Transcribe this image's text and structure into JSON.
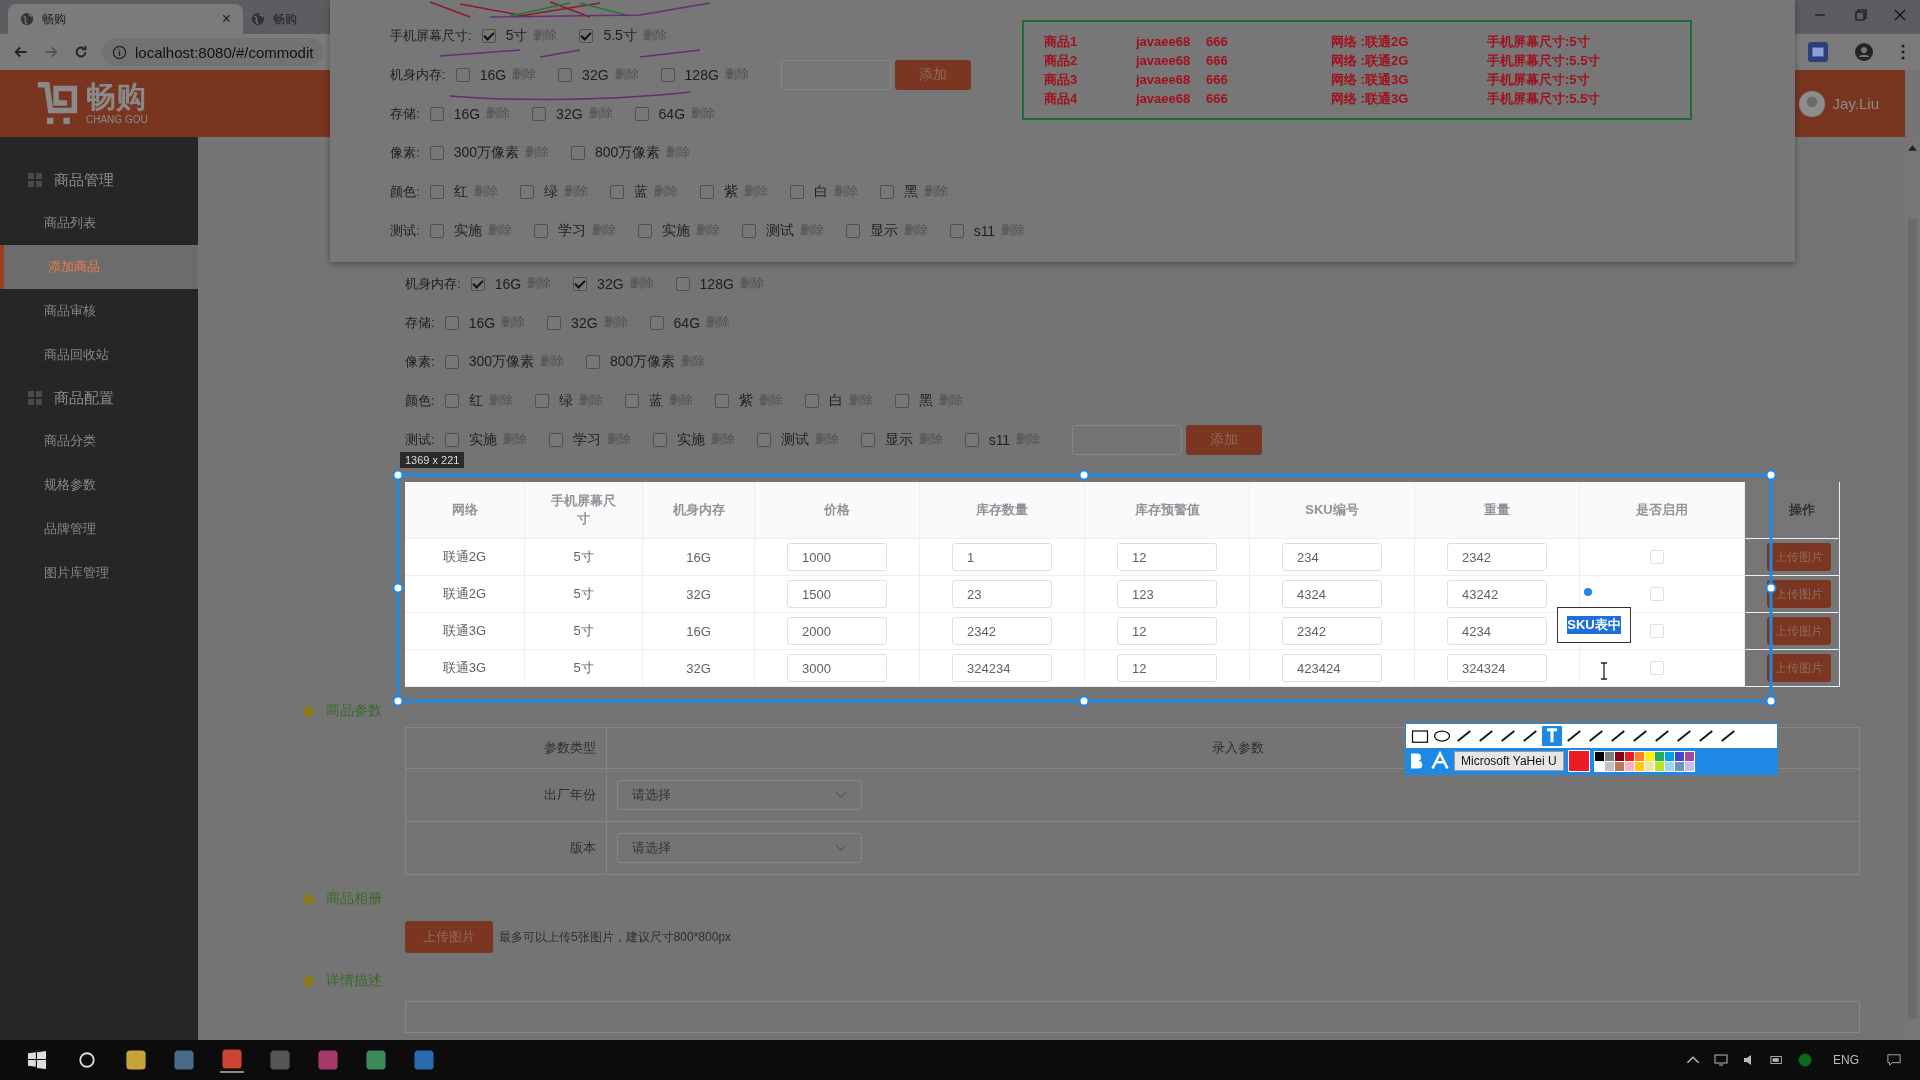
{
  "browser": {
    "tabs": [
      {
        "title": "畅购",
        "selected": true,
        "close": "×"
      },
      {
        "title": "畅购",
        "selected": false
      }
    ],
    "url": "localhost:8080/#/commodit"
  },
  "header": {
    "logo": "畅购",
    "logo_sub": "CHANG GOU",
    "user": "Jay.Liu"
  },
  "sidebar": [
    {
      "title": "商品管理",
      "items": [
        {
          "label": "商品列表",
          "selected": false
        },
        {
          "label": "添加商品",
          "selected": true
        },
        {
          "label": "商品审核",
          "selected": false
        },
        {
          "label": "商品回收站",
          "selected": false
        }
      ]
    },
    {
      "title": "商品配置",
      "items": [
        {
          "label": "商品分类",
          "selected": false
        },
        {
          "label": "规格参数",
          "selected": false
        },
        {
          "label": "品牌管理",
          "selected": false
        },
        {
          "label": "图片库管理",
          "selected": false
        }
      ]
    }
  ],
  "specs": [
    {
      "label": "机身内存:",
      "options": [
        {
          "label": "16G",
          "checked": true,
          "action": "删除"
        },
        {
          "label": "32G",
          "checked": true,
          "action": "删除"
        },
        {
          "label": "128G",
          "checked": false,
          "action": "删除"
        }
      ]
    },
    {
      "label": "存储:",
      "options": [
        {
          "label": "16G",
          "checked": false,
          "action": "删除"
        },
        {
          "label": "32G",
          "checked": false,
          "action": "删除"
        },
        {
          "label": "64G",
          "checked": false,
          "action": "删除"
        }
      ]
    },
    {
      "label": "像素:",
      "options": [
        {
          "label": "300万像素",
          "checked": false,
          "action": "删除"
        },
        {
          "label": "800万像素",
          "checked": false,
          "action": "删除"
        }
      ]
    },
    {
      "label": "颜色:",
      "options": [
        {
          "label": "红",
          "checked": false,
          "action": "删除"
        },
        {
          "label": "绿",
          "checked": false,
          "action": "删除"
        },
        {
          "label": "蓝",
          "checked": false,
          "action": "删除"
        },
        {
          "label": "紫",
          "checked": false,
          "action": "删除"
        },
        {
          "label": "白",
          "checked": false,
          "action": "删除"
        },
        {
          "label": "黑",
          "checked": false,
          "action": "删除"
        }
      ]
    },
    {
      "label": "测试:",
      "add_button": "添加",
      "options": [
        {
          "label": "实施",
          "checked": false,
          "action": "删除"
        },
        {
          "label": "学习",
          "checked": false,
          "action": "删除"
        },
        {
          "label": "实施",
          "checked": false,
          "action": "删除"
        },
        {
          "label": "测试",
          "checked": false,
          "action": "删除"
        },
        {
          "label": "显示",
          "checked": false,
          "action": "删除"
        },
        {
          "label": "s11",
          "checked": false,
          "action": "删除"
        }
      ]
    }
  ],
  "sku_table": {
    "columns": [
      "网络",
      "手机屏幕尺寸",
      "机身内存",
      "价格",
      "库存数量",
      "库存预警值",
      "SKU编号",
      "重量",
      "是否启用",
      "操作"
    ],
    "rows": [
      {
        "network": "联通2G",
        "screen": "5寸",
        "memory": "16G",
        "price": "1000",
        "stock": "1",
        "alert": "12",
        "sku": "234",
        "weight": "2342",
        "enabled": false,
        "action": "上传图片"
      },
      {
        "network": "联通2G",
        "screen": "5寸",
        "memory": "32G",
        "price": "1500",
        "stock": "23",
        "alert": "123",
        "sku": "4324",
        "weight": "43242",
        "enabled": false,
        "action": "上传图片"
      },
      {
        "network": "联通3G",
        "screen": "5寸",
        "memory": "16G",
        "price": "2000",
        "stock": "2342",
        "alert": "12",
        "sku": "2342",
        "weight": "4234",
        "enabled": false,
        "action": "上传图片"
      },
      {
        "network": "联通3G",
        "screen": "5寸",
        "memory": "32G",
        "price": "3000",
        "stock": "324234",
        "alert": "12",
        "sku": "423424",
        "weight": "324324",
        "enabled": false,
        "action": "上传图片"
      }
    ]
  },
  "params": {
    "title": "商品参数",
    "columns": [
      "参数类型",
      "录入参数"
    ],
    "rows": [
      {
        "label": "出厂年份",
        "placeholder": "请选择"
      },
      {
        "label": "版本",
        "placeholder": "请选择"
      }
    ]
  },
  "album": {
    "title": "商品相册",
    "button": "上传图片",
    "hint": "最多可以上传5张图片，建议尺寸800*800px"
  },
  "detail": {
    "title": "详情描述"
  },
  "pinned": {
    "specs": [
      {
        "label": "手机屏幕尺寸:",
        "options": [
          {
            "label": "5寸",
            "checked": true,
            "action": "删除"
          },
          {
            "label": "5.5寸",
            "checked": true,
            "action": "删除"
          }
        ]
      },
      {
        "label": "机身内存:",
        "add_button": "添加",
        "options": [
          {
            "label": "16G",
            "checked": false,
            "action": "删除"
          },
          {
            "label": "32G",
            "checked": false,
            "action": "删除"
          },
          {
            "label": "128G",
            "checked": false,
            "action": "删除"
          }
        ]
      },
      {
        "label": "存储:",
        "options": [
          {
            "label": "16G",
            "checked": false,
            "action": "删除"
          },
          {
            "label": "32G",
            "checked": false,
            "action": "删除"
          },
          {
            "label": "64G",
            "checked": false,
            "action": "删除"
          }
        ]
      },
      {
        "label": "像素:",
        "options": [
          {
            "label": "300万像素",
            "checked": false,
            "action": "删除"
          },
          {
            "label": "800万像素",
            "checked": false,
            "action": "删除"
          }
        ]
      },
      {
        "label": "颜色:",
        "options": [
          {
            "label": "红",
            "checked": false,
            "action": "删除"
          },
          {
            "label": "绿",
            "checked": false,
            "action": "删除"
          },
          {
            "label": "蓝",
            "checked": false,
            "action": "删除"
          },
          {
            "label": "紫",
            "checked": false,
            "action": "删除"
          },
          {
            "label": "白",
            "checked": false,
            "action": "删除"
          },
          {
            "label": "黑",
            "checked": false,
            "action": "删除"
          }
        ]
      },
      {
        "label": "测试:",
        "options": [
          {
            "label": "实施",
            "checked": false,
            "action": "删除"
          },
          {
            "label": "学习",
            "checked": false,
            "action": "删除"
          },
          {
            "label": "实施",
            "checked": false,
            "action": "删除"
          },
          {
            "label": "测试",
            "checked": false,
            "action": "删除"
          },
          {
            "label": "显示",
            "checked": false,
            "action": "删除"
          },
          {
            "label": "s11",
            "checked": false,
            "action": "删除"
          }
        ]
      }
    ],
    "products": [
      {
        "name": "商品1",
        "user": "javaee68",
        "count": "666",
        "network": "网络 :联通2G",
        "screen": "手机屏幕尺寸:5寸"
      },
      {
        "name": "商品2",
        "user": "javaee68",
        "count": "666",
        "network": "网络 :联通2G",
        "screen": "手机屏幕尺寸:5.5寸"
      },
      {
        "name": "商品3",
        "user": "javaee68",
        "count": "666",
        "network": "网络 :联通3G",
        "screen": "手机屏幕尺寸:5寸"
      },
      {
        "name": "商品4",
        "user": "javaee68",
        "count": "666",
        "network": "网络 :联通3G",
        "screen": "手机屏幕尺寸:5.5寸"
      }
    ]
  },
  "capture": {
    "size": "1369 x 221",
    "text": "SKU表中",
    "font": "Microsoft YaHei U"
  },
  "taskbar": {
    "lang": "ENG"
  }
}
